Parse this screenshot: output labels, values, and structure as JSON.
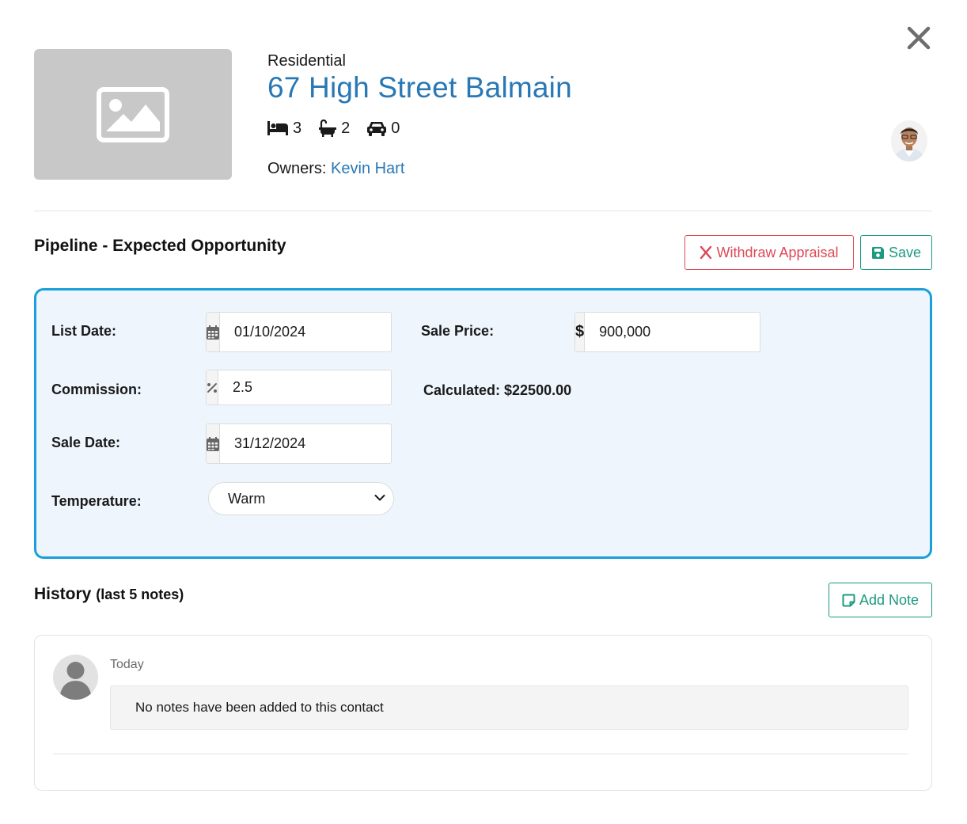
{
  "property": {
    "type": "Residential",
    "address": "67 High Street Balmain",
    "features": {
      "bedrooms": "3",
      "bathrooms": "2",
      "car_spaces": "0"
    },
    "owners_label": "Owners:",
    "owner_name": "Kevin Hart"
  },
  "pipeline": {
    "title": "Pipeline - Expected Opportunity",
    "withdraw_label": "Withdraw Appraisal",
    "save_label": "Save",
    "list_date_label": "List Date:",
    "list_date": "01/10/2024",
    "sale_price_label": "Sale Price:",
    "currency_symbol": "$",
    "sale_price": "900,000",
    "commission_label": "Commission:",
    "commission": "2.5",
    "calculated_text": "Calculated: $22500.00",
    "sale_date_label": "Sale Date:",
    "sale_date": "31/12/2024",
    "temperature_label": "Temperature:",
    "temperature": "Warm"
  },
  "history": {
    "title": "History",
    "subtitle": "(last 5 notes)",
    "add_note_label": "Add Note",
    "notes": [
      {
        "date": "Today",
        "text": "No notes have been added to this contact"
      }
    ]
  },
  "colors": {
    "link": "#2878b5",
    "danger": "#dc4a56",
    "success": "#1d9a80",
    "panel_border": "#1a9fd9",
    "panel_bg": "#eef5fd"
  },
  "icons": [
    "close-icon",
    "image-placeholder-icon",
    "bed-icon",
    "bath-icon",
    "car-icon",
    "times-icon",
    "save-icon",
    "calendar-icon",
    "percent-icon",
    "chevron-down-icon",
    "sticky-note-icon",
    "user-silhouette-icon"
  ]
}
